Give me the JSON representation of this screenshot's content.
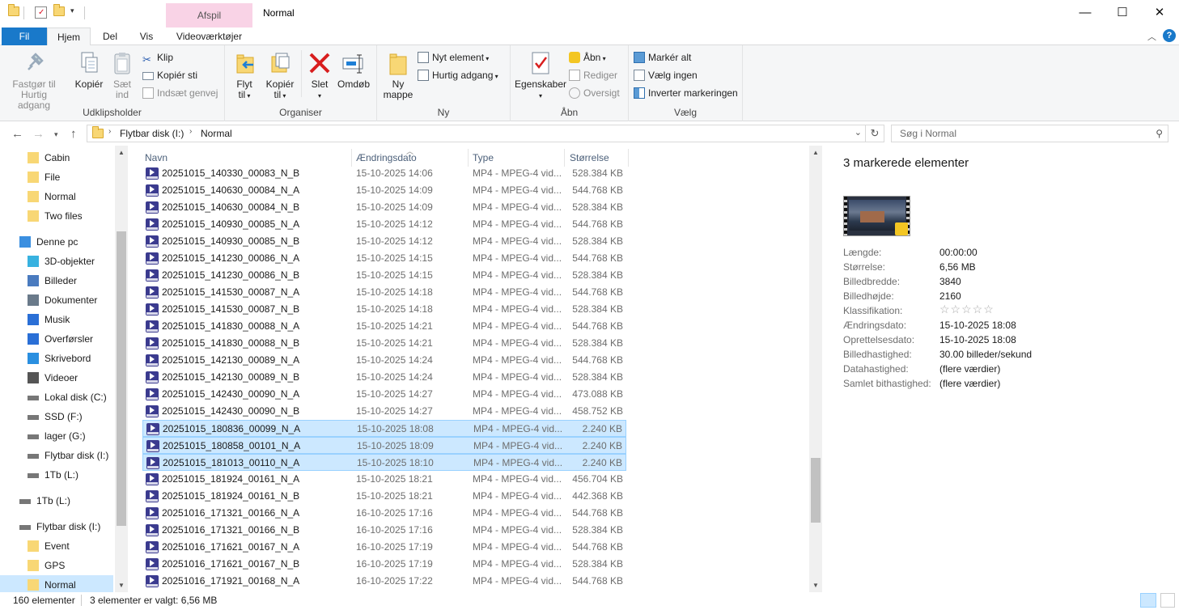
{
  "titlebar": {
    "context_tab": "Afspil",
    "title": "Normal",
    "minimize": "—",
    "maximize": "☐",
    "close": "✕"
  },
  "tabs": {
    "fil": "Fil",
    "hjem": "Hjem",
    "del": "Del",
    "vis": "Vis",
    "videovaerktojer": "Videoværktøjer"
  },
  "ribbon": {
    "udklipsholder": {
      "label": "Udklipsholder",
      "fastgor": "Fastgør til\nHurtig adgang",
      "fastgor_l1": "Fastgør til",
      "fastgor_l2": "Hurtig adgang",
      "kopier": "Kopiér",
      "saet_l1": "Sæt",
      "saet_l2": "ind",
      "klip": "Klip",
      "kopier_sti": "Kopiér sti",
      "indsaet_genvej": "Indsæt genvej"
    },
    "organiser": {
      "label": "Organiser",
      "flyt_l1": "Flyt",
      "flyt_l2": "til",
      "kopier_l1": "Kopiér",
      "kopier_l2": "til",
      "slet": "Slet",
      "omdob": "Omdøb"
    },
    "ny": {
      "label": "Ny",
      "ny_l1": "Ny",
      "ny_l2": "mappe",
      "nyt_element": "Nyt element",
      "hurtig_adgang": "Hurtig adgang"
    },
    "aabn": {
      "label": "Åbn",
      "egenskaber": "Egenskaber",
      "aabn": "Åbn",
      "rediger": "Rediger",
      "oversigt": "Oversigt"
    },
    "vaelg": {
      "label": "Vælg",
      "marker_alt": "Markér alt",
      "vaelg_ingen": "Vælg ingen",
      "inverter": "Inverter markeringen"
    }
  },
  "address": {
    "crumb1": "Flytbar disk (I:)",
    "crumb2": "Normal",
    "search_placeholder": "Søg i Normal"
  },
  "nav": [
    {
      "label": "Cabin",
      "icon": "folder"
    },
    {
      "label": "File",
      "icon": "folder"
    },
    {
      "label": "Normal",
      "icon": "folder"
    },
    {
      "label": "Two files",
      "icon": "folder"
    },
    {
      "label": "Denne pc",
      "icon": "pc"
    },
    {
      "label": "3D-objekter",
      "icon": "3d"
    },
    {
      "label": "Billeder",
      "icon": "pictures"
    },
    {
      "label": "Dokumenter",
      "icon": "documents"
    },
    {
      "label": "Musik",
      "icon": "music"
    },
    {
      "label": "Overførsler",
      "icon": "downloads"
    },
    {
      "label": "Skrivebord",
      "icon": "desktop"
    },
    {
      "label": "Videoer",
      "icon": "videos"
    },
    {
      "label": "Lokal disk (C:)",
      "icon": "drive"
    },
    {
      "label": "SSD (F:)",
      "icon": "drive"
    },
    {
      "label": "lager (G:)",
      "icon": "drive"
    },
    {
      "label": "Flytbar disk (I:)",
      "icon": "drive"
    },
    {
      "label": "1Tb (L:)",
      "icon": "drive"
    },
    {
      "label": "1Tb (L:)",
      "icon": "drive"
    },
    {
      "label": "Flytbar disk (I:)",
      "icon": "drive"
    },
    {
      "label": "Event",
      "icon": "folder"
    },
    {
      "label": "GPS",
      "icon": "folder"
    },
    {
      "label": "Normal",
      "icon": "folder"
    }
  ],
  "columns": {
    "navn": "Navn",
    "dato": "Ændringsdato",
    "type": "Type",
    "storrelse": "Størrelse"
  },
  "files": [
    {
      "name": "20251015_140330_00083_N_B",
      "date": "15-10-2025 14:06",
      "type": "MP4 - MPEG-4 vid...",
      "size": "528.384 KB",
      "selected": false
    },
    {
      "name": "20251015_140630_00084_N_A",
      "date": "15-10-2025 14:09",
      "type": "MP4 - MPEG-4 vid...",
      "size": "544.768 KB",
      "selected": false
    },
    {
      "name": "20251015_140630_00084_N_B",
      "date": "15-10-2025 14:09",
      "type": "MP4 - MPEG-4 vid...",
      "size": "528.384 KB",
      "selected": false
    },
    {
      "name": "20251015_140930_00085_N_A",
      "date": "15-10-2025 14:12",
      "type": "MP4 - MPEG-4 vid...",
      "size": "544.768 KB",
      "selected": false
    },
    {
      "name": "20251015_140930_00085_N_B",
      "date": "15-10-2025 14:12",
      "type": "MP4 - MPEG-4 vid...",
      "size": "528.384 KB",
      "selected": false
    },
    {
      "name": "20251015_141230_00086_N_A",
      "date": "15-10-2025 14:15",
      "type": "MP4 - MPEG-4 vid...",
      "size": "544.768 KB",
      "selected": false
    },
    {
      "name": "20251015_141230_00086_N_B",
      "date": "15-10-2025 14:15",
      "type": "MP4 - MPEG-4 vid...",
      "size": "528.384 KB",
      "selected": false
    },
    {
      "name": "20251015_141530_00087_N_A",
      "date": "15-10-2025 14:18",
      "type": "MP4 - MPEG-4 vid...",
      "size": "544.768 KB",
      "selected": false
    },
    {
      "name": "20251015_141530_00087_N_B",
      "date": "15-10-2025 14:18",
      "type": "MP4 - MPEG-4 vid...",
      "size": "528.384 KB",
      "selected": false
    },
    {
      "name": "20251015_141830_00088_N_A",
      "date": "15-10-2025 14:21",
      "type": "MP4 - MPEG-4 vid...",
      "size": "544.768 KB",
      "selected": false
    },
    {
      "name": "20251015_141830_00088_N_B",
      "date": "15-10-2025 14:21",
      "type": "MP4 - MPEG-4 vid...",
      "size": "528.384 KB",
      "selected": false
    },
    {
      "name": "20251015_142130_00089_N_A",
      "date": "15-10-2025 14:24",
      "type": "MP4 - MPEG-4 vid...",
      "size": "544.768 KB",
      "selected": false
    },
    {
      "name": "20251015_142130_00089_N_B",
      "date": "15-10-2025 14:24",
      "type": "MP4 - MPEG-4 vid...",
      "size": "528.384 KB",
      "selected": false
    },
    {
      "name": "20251015_142430_00090_N_A",
      "date": "15-10-2025 14:27",
      "type": "MP4 - MPEG-4 vid...",
      "size": "473.088 KB",
      "selected": false
    },
    {
      "name": "20251015_142430_00090_N_B",
      "date": "15-10-2025 14:27",
      "type": "MP4 - MPEG-4 vid...",
      "size": "458.752 KB",
      "selected": false
    },
    {
      "name": "20251015_180836_00099_N_A",
      "date": "15-10-2025 18:08",
      "type": "MP4 - MPEG-4 vid...",
      "size": "2.240 KB",
      "selected": true
    },
    {
      "name": "20251015_180858_00101_N_A",
      "date": "15-10-2025 18:09",
      "type": "MP4 - MPEG-4 vid...",
      "size": "2.240 KB",
      "selected": true
    },
    {
      "name": "20251015_181013_00110_N_A",
      "date": "15-10-2025 18:10",
      "type": "MP4 - MPEG-4 vid...",
      "size": "2.240 KB",
      "selected": true
    },
    {
      "name": "20251015_181924_00161_N_A",
      "date": "15-10-2025 18:21",
      "type": "MP4 - MPEG-4 vid...",
      "size": "456.704 KB",
      "selected": false
    },
    {
      "name": "20251015_181924_00161_N_B",
      "date": "15-10-2025 18:21",
      "type": "MP4 - MPEG-4 vid...",
      "size": "442.368 KB",
      "selected": false
    },
    {
      "name": "20251016_171321_00166_N_A",
      "date": "16-10-2025 17:16",
      "type": "MP4 - MPEG-4 vid...",
      "size": "544.768 KB",
      "selected": false
    },
    {
      "name": "20251016_171321_00166_N_B",
      "date": "16-10-2025 17:16",
      "type": "MP4 - MPEG-4 vid...",
      "size": "528.384 KB",
      "selected": false
    },
    {
      "name": "20251016_171621_00167_N_A",
      "date": "16-10-2025 17:19",
      "type": "MP4 - MPEG-4 vid...",
      "size": "544.768 KB",
      "selected": false
    },
    {
      "name": "20251016_171621_00167_N_B",
      "date": "16-10-2025 17:19",
      "type": "MP4 - MPEG-4 vid...",
      "size": "528.384 KB",
      "selected": false
    },
    {
      "name": "20251016_171921_00168_N_A",
      "date": "16-10-2025 17:22",
      "type": "MP4 - MPEG-4 vid...",
      "size": "544.768 KB",
      "selected": false
    }
  ],
  "details": {
    "title": "3 markerede elementer",
    "props": [
      {
        "label": "Længde:",
        "value": "00:00:00"
      },
      {
        "label": "Størrelse:",
        "value": "6,56 MB"
      },
      {
        "label": "Billedbredde:",
        "value": "3840"
      },
      {
        "label": "Billedhøjde:",
        "value": "2160"
      },
      {
        "label": "Klassifikation:",
        "value": "☆☆☆☆☆"
      },
      {
        "label": "Ændringsdato:",
        "value": "15-10-2025 18:08"
      },
      {
        "label": "Oprettelsesdato:",
        "value": "15-10-2025 18:08"
      },
      {
        "label": "Billedhastighed:",
        "value": "30.00 billeder/sekund"
      },
      {
        "label": "Datahastighed:",
        "value": "(flere værdier)"
      },
      {
        "label": "Samlet bithastighed:",
        "value": "(flere værdier)"
      }
    ]
  },
  "status": {
    "count": "160 elementer",
    "selected": "3 elementer er valgt: 6,56 MB"
  }
}
